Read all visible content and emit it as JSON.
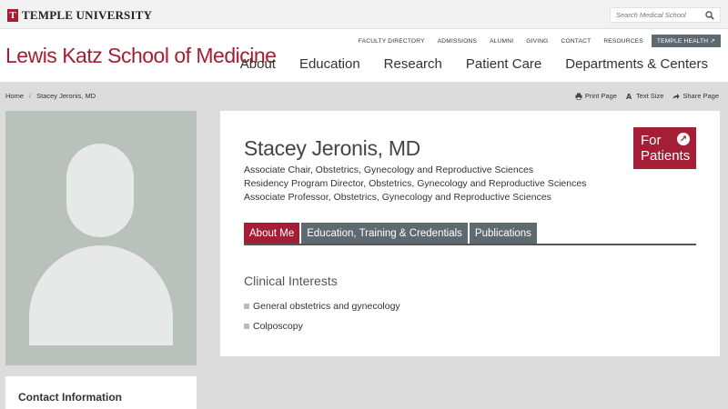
{
  "university": {
    "name": "TEMPLE UNIVERSITY",
    "mark": "T"
  },
  "search": {
    "placeholder": "Search Medical School"
  },
  "header": {
    "school_title": "Lewis Katz School of Medicine",
    "utility_links": [
      "FACULTY DIRECTORY",
      "ADMISSIONS",
      "ALUMNI",
      "GIVING",
      "CONTACT",
      "RESOURCES"
    ],
    "temple_health": "TEMPLE HEALTH ↗",
    "main_nav": [
      "About",
      "Education",
      "Research",
      "Patient Care",
      "Departments & Centers"
    ]
  },
  "breadcrumb": {
    "home": "Home",
    "separator": "/",
    "current": "Stacey Jeronis, MD"
  },
  "tools": {
    "print": "Print Page",
    "text_size": "Text Size",
    "share": "Share Page"
  },
  "profile": {
    "name": "Stacey Jeronis, MD",
    "titles": [
      "Associate Chair, Obstetrics, Gynecology and Reproductive Sciences",
      "Residency Program Director, Obstetrics, Gynecology and Reproductive Sciences",
      "Associate Professor, Obstetrics, Gynecology and Reproductive Sciences"
    ],
    "for_patients_line1": "For",
    "for_patients_line2": "Patients",
    "for_patients_arrow": "↗"
  },
  "tabs": [
    {
      "label": "About Me",
      "active": true
    },
    {
      "label": "Education, Training & Credentials",
      "active": false
    },
    {
      "label": "Publications",
      "active": false
    }
  ],
  "clinical": {
    "heading": "Clinical Interests",
    "items": [
      "General obstetrics and gynecology",
      "Colposcopy"
    ]
  },
  "contact": {
    "heading": "Contact Information"
  },
  "colors": {
    "brand": "#a41e35",
    "tab_gray": "#5f6a70",
    "page_bg": "#dcdcdc"
  }
}
